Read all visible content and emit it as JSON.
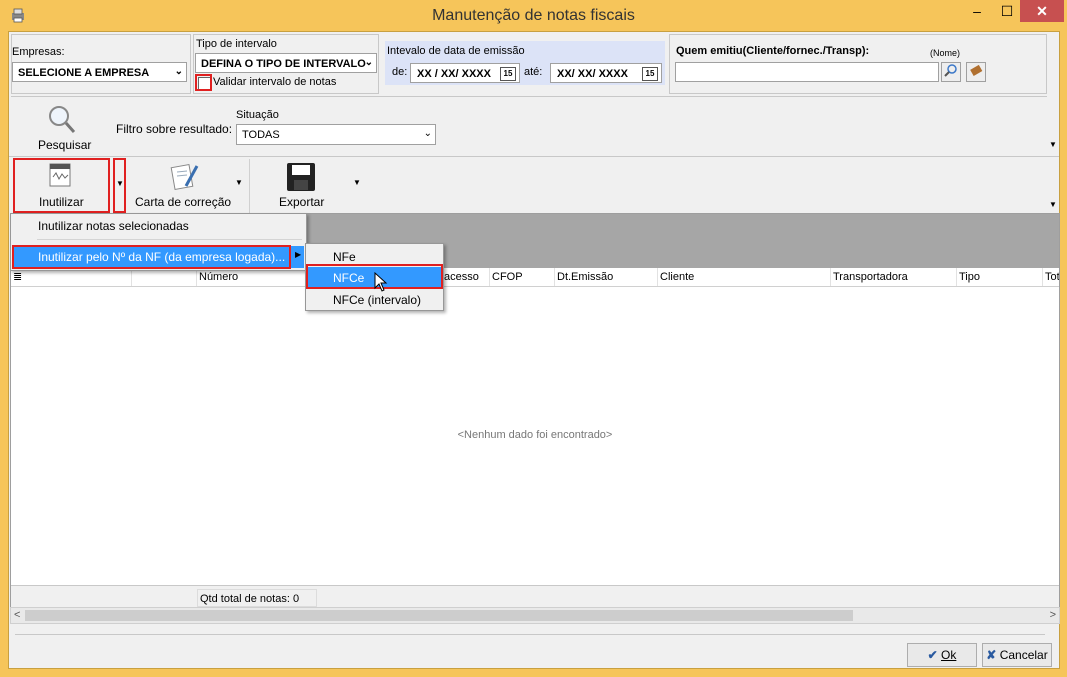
{
  "window": {
    "title": "Manutenção de notas fiscais",
    "min": "–",
    "max": "☐",
    "close": "✕"
  },
  "filters": {
    "empresas_label": "Empresas:",
    "empresas_value": "SELECIONE A EMPRESA",
    "tipo_label": "Tipo de intervalo",
    "tipo_value": "DEFINA O TIPO DE INTERVALO",
    "validar_label": "Validar intervalo de notas",
    "data_label": "Intevalo de data de emissão",
    "de_label": "de:",
    "de_value": "XX / XX/ XXXX",
    "ate_label": "até:",
    "ate_value": "XX/ XX/ XXXX",
    "cal_icon": "15",
    "quem_label": "Quem emitiu(Cliente/fornec./Transp):",
    "nome_hint": "(Nome)",
    "quem_value": ""
  },
  "search": {
    "pesquisar_label": "Pesquisar",
    "filtro_label": "Filtro sobre resultado:",
    "situacao_label": "Situação",
    "situacao_value": "TODAS"
  },
  "toolbar": {
    "inutilizar_label": "Inutilizar",
    "carta_label": "Carta de correção",
    "exportar_label": "Exportar"
  },
  "menu": {
    "item1": "Inutilizar notas selecionadas",
    "item2": "Inutilizar pelo Nº da NF (da empresa logada)...",
    "sub": [
      "NFe",
      "NFCe",
      "NFCe (intervalo)"
    ]
  },
  "grid": {
    "columns": [
      "Número",
      "acesso",
      "CFOP",
      "Dt.Emissão",
      "Cliente",
      "Transportadora",
      "Tipo",
      "Tot"
    ],
    "empty_message": "<Nenhum dado foi encontrado>",
    "total_label": "Qtd total de notas: 0"
  },
  "buttons": {
    "ok": "Ok",
    "cancel": "Cancelar"
  },
  "colors": {
    "frame": "#f6c55a",
    "selection": "#3399ff",
    "highlight": "#e02020",
    "date_panel": "#dce3f7"
  }
}
